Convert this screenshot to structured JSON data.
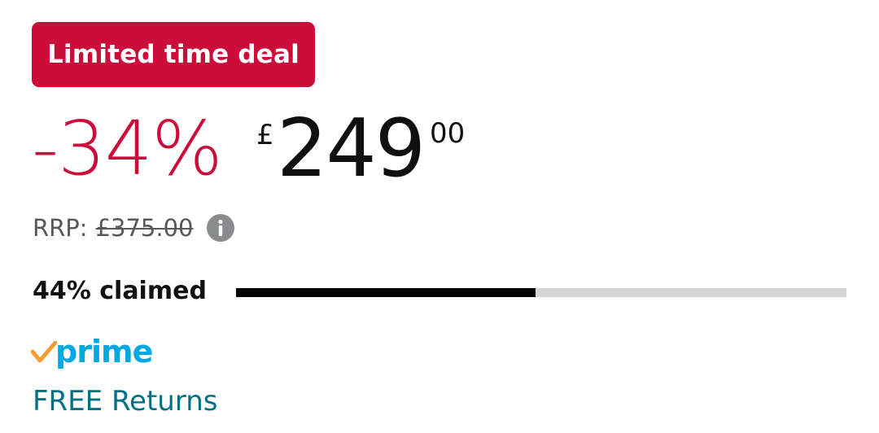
{
  "deal_badge": {
    "label": "Limited time deal",
    "color": "#cc0c39"
  },
  "price": {
    "discount": "-34%",
    "currency": "£",
    "whole": "249",
    "fraction": "00",
    "discount_color": "#cc0c39"
  },
  "rrp": {
    "label": "RRP:",
    "value": "£375.00",
    "info_icon": "info-circle-icon"
  },
  "claimed": {
    "label": "44% claimed",
    "progress_fraction": 0.44
  },
  "prime": {
    "icon": "prime-check-icon",
    "label": "prime",
    "color": "#00a8e1"
  },
  "returns": {
    "label": "FREE Returns",
    "color": "#007185"
  }
}
